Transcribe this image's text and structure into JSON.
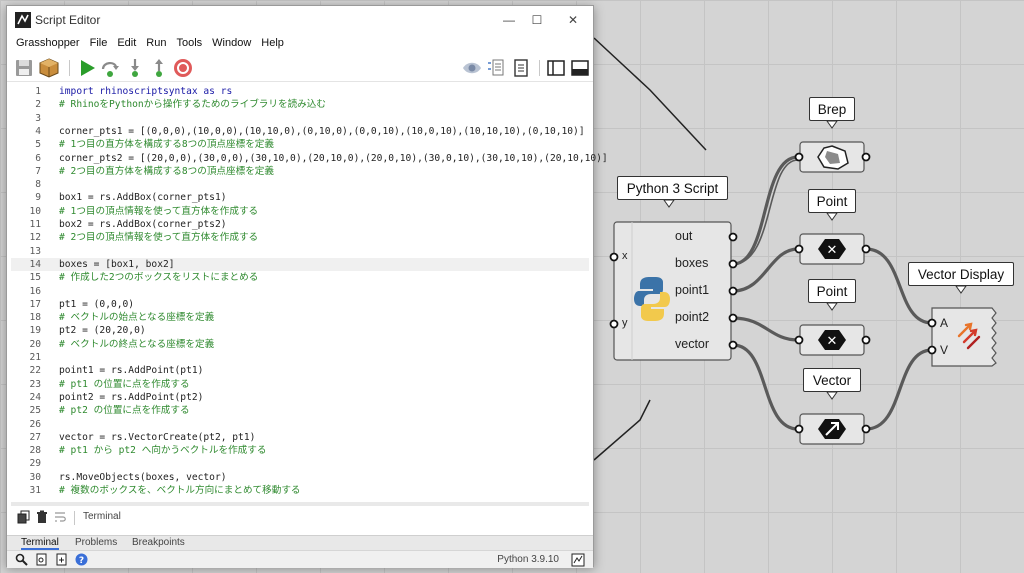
{
  "window": {
    "title": "Script Editor",
    "controls": {
      "minimize": "—",
      "maximize": "☐",
      "close": "✕"
    }
  },
  "menu": [
    "Grasshopper",
    "File",
    "Edit",
    "Run",
    "Tools",
    "Window",
    "Help"
  ],
  "editor": {
    "active_line": 14,
    "lines": [
      {
        "n": "1",
        "text": "import rhinoscriptsyntax as rs",
        "kind": "import"
      },
      {
        "n": "2",
        "text": "# RhinoをPythonから操作するためのライブラリを読み込む",
        "kind": "comment"
      },
      {
        "n": "3",
        "text": "",
        "kind": "code"
      },
      {
        "n": "4",
        "text": "corner_pts1 = [(0,0,0),(10,0,0),(10,10,0),(0,10,0),(0,0,10),(10,0,10),(10,10,10),(0,10,10)]",
        "kind": "code"
      },
      {
        "n": "5",
        "text": "# 1つ目の直方体を構成する8つの頂点座標を定義",
        "kind": "comment"
      },
      {
        "n": "6",
        "text": "corner_pts2 = [(20,0,0),(30,0,0),(30,10,0),(20,10,0),(20,0,10),(30,0,10),(30,10,10),(20,10,10)]",
        "kind": "code"
      },
      {
        "n": "7",
        "text": "# 2つ目の直方体を構成する8つの頂点座標を定義",
        "kind": "comment"
      },
      {
        "n": "8",
        "text": "",
        "kind": "code"
      },
      {
        "n": "9",
        "text": "box1 = rs.AddBox(corner_pts1)",
        "kind": "code"
      },
      {
        "n": "10",
        "text": "# 1つ目の頂点情報を使って直方体を作成する",
        "kind": "comment"
      },
      {
        "n": "11",
        "text": "box2 = rs.AddBox(corner_pts2)",
        "kind": "code"
      },
      {
        "n": "12",
        "text": "# 2つ目の頂点情報を使って直方体を作成する",
        "kind": "comment"
      },
      {
        "n": "13",
        "text": "",
        "kind": "code"
      },
      {
        "n": "14",
        "text": "boxes = [box1, box2]",
        "kind": "code"
      },
      {
        "n": "15",
        "text": "# 作成した2つのボックスをリストにまとめる",
        "kind": "comment"
      },
      {
        "n": "16",
        "text": "",
        "kind": "code"
      },
      {
        "n": "17",
        "text": "pt1 = (0,0,0)",
        "kind": "code"
      },
      {
        "n": "18",
        "text": "# ベクトルの始点となる座標を定義",
        "kind": "comment"
      },
      {
        "n": "19",
        "text": "pt2 = (20,20,0)",
        "kind": "code"
      },
      {
        "n": "20",
        "text": "# ベクトルの終点となる座標を定義",
        "kind": "comment"
      },
      {
        "n": "21",
        "text": "",
        "kind": "code"
      },
      {
        "n": "22",
        "text": "point1 = rs.AddPoint(pt1)",
        "kind": "code"
      },
      {
        "n": "23",
        "text": "# pt1 の位置に点を作成する",
        "kind": "comment"
      },
      {
        "n": "24",
        "text": "point2 = rs.AddPoint(pt2)",
        "kind": "code"
      },
      {
        "n": "25",
        "text": "# pt2 の位置に点を作成する",
        "kind": "comment"
      },
      {
        "n": "26",
        "text": "",
        "kind": "code"
      },
      {
        "n": "27",
        "text": "vector = rs.VectorCreate(pt2, pt1)",
        "kind": "code"
      },
      {
        "n": "28",
        "text": "# pt1 から pt2 へ向かうベクトルを作成する",
        "kind": "comment"
      },
      {
        "n": "29",
        "text": "",
        "kind": "code"
      },
      {
        "n": "30",
        "text": "rs.MoveObjects(boxes, vector)",
        "kind": "code"
      },
      {
        "n": "31",
        "text": "# 複数のボックスを、ベクトル方向にまとめて移動する",
        "kind": "comment"
      }
    ]
  },
  "terminal": {
    "label": "Terminal"
  },
  "bottom_tabs": [
    "Terminal",
    "Problems",
    "Breakpoints"
  ],
  "status": {
    "python_version": "Python 3.9.10"
  },
  "canvas": {
    "python_component": {
      "balloon": "Python 3 Script",
      "inputs": [
        "x",
        "y"
      ],
      "outputs": [
        "out",
        "boxes",
        "point1",
        "point2",
        "vector"
      ]
    },
    "brep": {
      "balloon": "Brep"
    },
    "point1": {
      "balloon": "Point"
    },
    "point2": {
      "balloon": "Point"
    },
    "vector": {
      "balloon": "Vector"
    },
    "vector_display": {
      "balloon": "Vector Display",
      "inputs": [
        "A",
        "V"
      ]
    }
  },
  "colors": {
    "comment": "#2f8a2f",
    "keyword": "#1a1aa6",
    "component_fill": "#e6e6e6",
    "wire": "#5a5a5a"
  }
}
